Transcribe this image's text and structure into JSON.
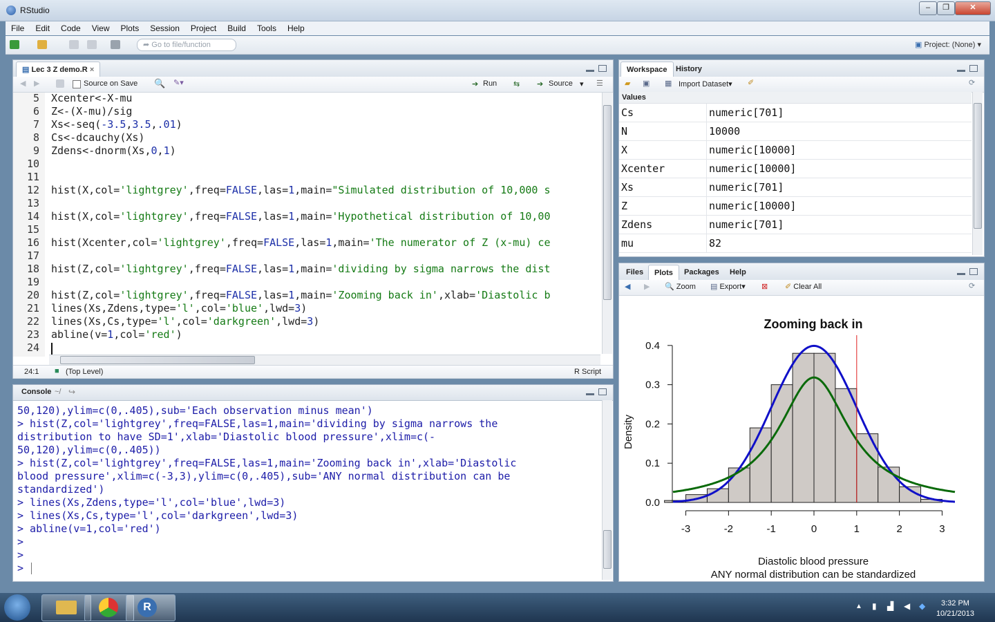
{
  "window": {
    "title": "RStudio"
  },
  "menu": [
    "File",
    "Edit",
    "Code",
    "View",
    "Plots",
    "Session",
    "Project",
    "Build",
    "Tools",
    "Help"
  ],
  "toolbar": {
    "goto_placeholder": "Go to file/function",
    "project": "Project: (None)"
  },
  "editor": {
    "tab": "Lec 3 Z demo.R",
    "source_on_save": "Source on Save",
    "run": "Run",
    "source": "Source",
    "line_numbers": [
      "5",
      "6",
      "7",
      "8",
      "9",
      "10",
      "11",
      "12",
      "13",
      "14",
      "15",
      "16",
      "17",
      "18",
      "19",
      "20",
      "21",
      "22",
      "23",
      "24"
    ],
    "cursor_pos": "24:1",
    "scope": "(Top Level)",
    "filetype": "R Script"
  },
  "console": {
    "title": "Console",
    "path": "~/",
    "lines": [
      "50,120),ylim=c(0,.405),sub='Each observation minus mean')",
      "> hist(Z,col='lightgrey',freq=FALSE,las=1,main='dividing by sigma narrows the",
      "distribution to have SD=1',xlab='Diastolic blood pressure',xlim=c(-",
      "50,120),ylim=c(0,.405))",
      "> hist(Z,col='lightgrey',freq=FALSE,las=1,main='Zooming back in',xlab='Diastolic",
      "blood pressure',xlim=c(-3,3),ylim=c(0,.405),sub='ANY normal distribution can be",
      "standardized')",
      "> lines(Xs,Zdens,type='l',col='blue',lwd=3)",
      "> lines(Xs,Cs,type='l',col='darkgreen',lwd=3)",
      "> abline(v=1,col='red')",
      ">",
      ">",
      ">"
    ]
  },
  "workspace": {
    "tabs": [
      "Workspace",
      "History"
    ],
    "import": "Import Dataset",
    "section": "Values",
    "rows": [
      {
        "name": "Cs",
        "value": "numeric[701]"
      },
      {
        "name": "N",
        "value": "10000"
      },
      {
        "name": "X",
        "value": "numeric[10000]"
      },
      {
        "name": "Xcenter",
        "value": "numeric[10000]"
      },
      {
        "name": "Xs",
        "value": "numeric[701]"
      },
      {
        "name": "Z",
        "value": "numeric[10000]"
      },
      {
        "name": "Zdens",
        "value": "numeric[701]"
      },
      {
        "name": "mu",
        "value": "82"
      }
    ]
  },
  "plots_pane": {
    "tabs": [
      "Files",
      "Plots",
      "Packages",
      "Help"
    ],
    "zoom": "Zoom",
    "export": "Export",
    "clear": "Clear All"
  },
  "chart_data": {
    "type": "bar",
    "title": "Zooming back in",
    "xlabel": "Diastolic blood pressure",
    "subtitle": "ANY normal distribution can be standardized",
    "ylabel": "Density",
    "xlim": [
      -3.3,
      3.3
    ],
    "ylim": [
      0,
      0.405
    ],
    "x_ticks": [
      "-3",
      "-2",
      "-1",
      "0",
      "1",
      "2",
      "3"
    ],
    "y_ticks": [
      "0.0",
      "0.1",
      "0.2",
      "0.3",
      "0.4"
    ],
    "bins": [
      {
        "from": -3.5,
        "to": -3.0,
        "value": 0.005
      },
      {
        "from": -3.0,
        "to": -2.5,
        "value": 0.02
      },
      {
        "from": -2.5,
        "to": -2.0,
        "value": 0.035
      },
      {
        "from": -2.0,
        "to": -1.5,
        "value": 0.088
      },
      {
        "from": -1.5,
        "to": -1.0,
        "value": 0.19
      },
      {
        "from": -1.0,
        "to": -0.5,
        "value": 0.3
      },
      {
        "from": -0.5,
        "to": 0.0,
        "value": 0.38
      },
      {
        "from": 0.0,
        "to": 0.5,
        "value": 0.38
      },
      {
        "from": 0.5,
        "to": 1.0,
        "value": 0.29
      },
      {
        "from": 1.0,
        "to": 1.5,
        "value": 0.175
      },
      {
        "from": 1.5,
        "to": 2.0,
        "value": 0.09
      },
      {
        "from": 2.0,
        "to": 2.5,
        "value": 0.04
      },
      {
        "from": 2.5,
        "to": 3.0,
        "value": 0.008
      }
    ],
    "curves": [
      {
        "color": "#1010c8",
        "kind": "normal"
      },
      {
        "color": "#0a6a0a",
        "kind": "cauchy"
      }
    ],
    "vline": {
      "x": 1,
      "color": "#e02020"
    }
  },
  "taskbar": {
    "time": "3:32 PM",
    "date": "10/21/2013"
  }
}
